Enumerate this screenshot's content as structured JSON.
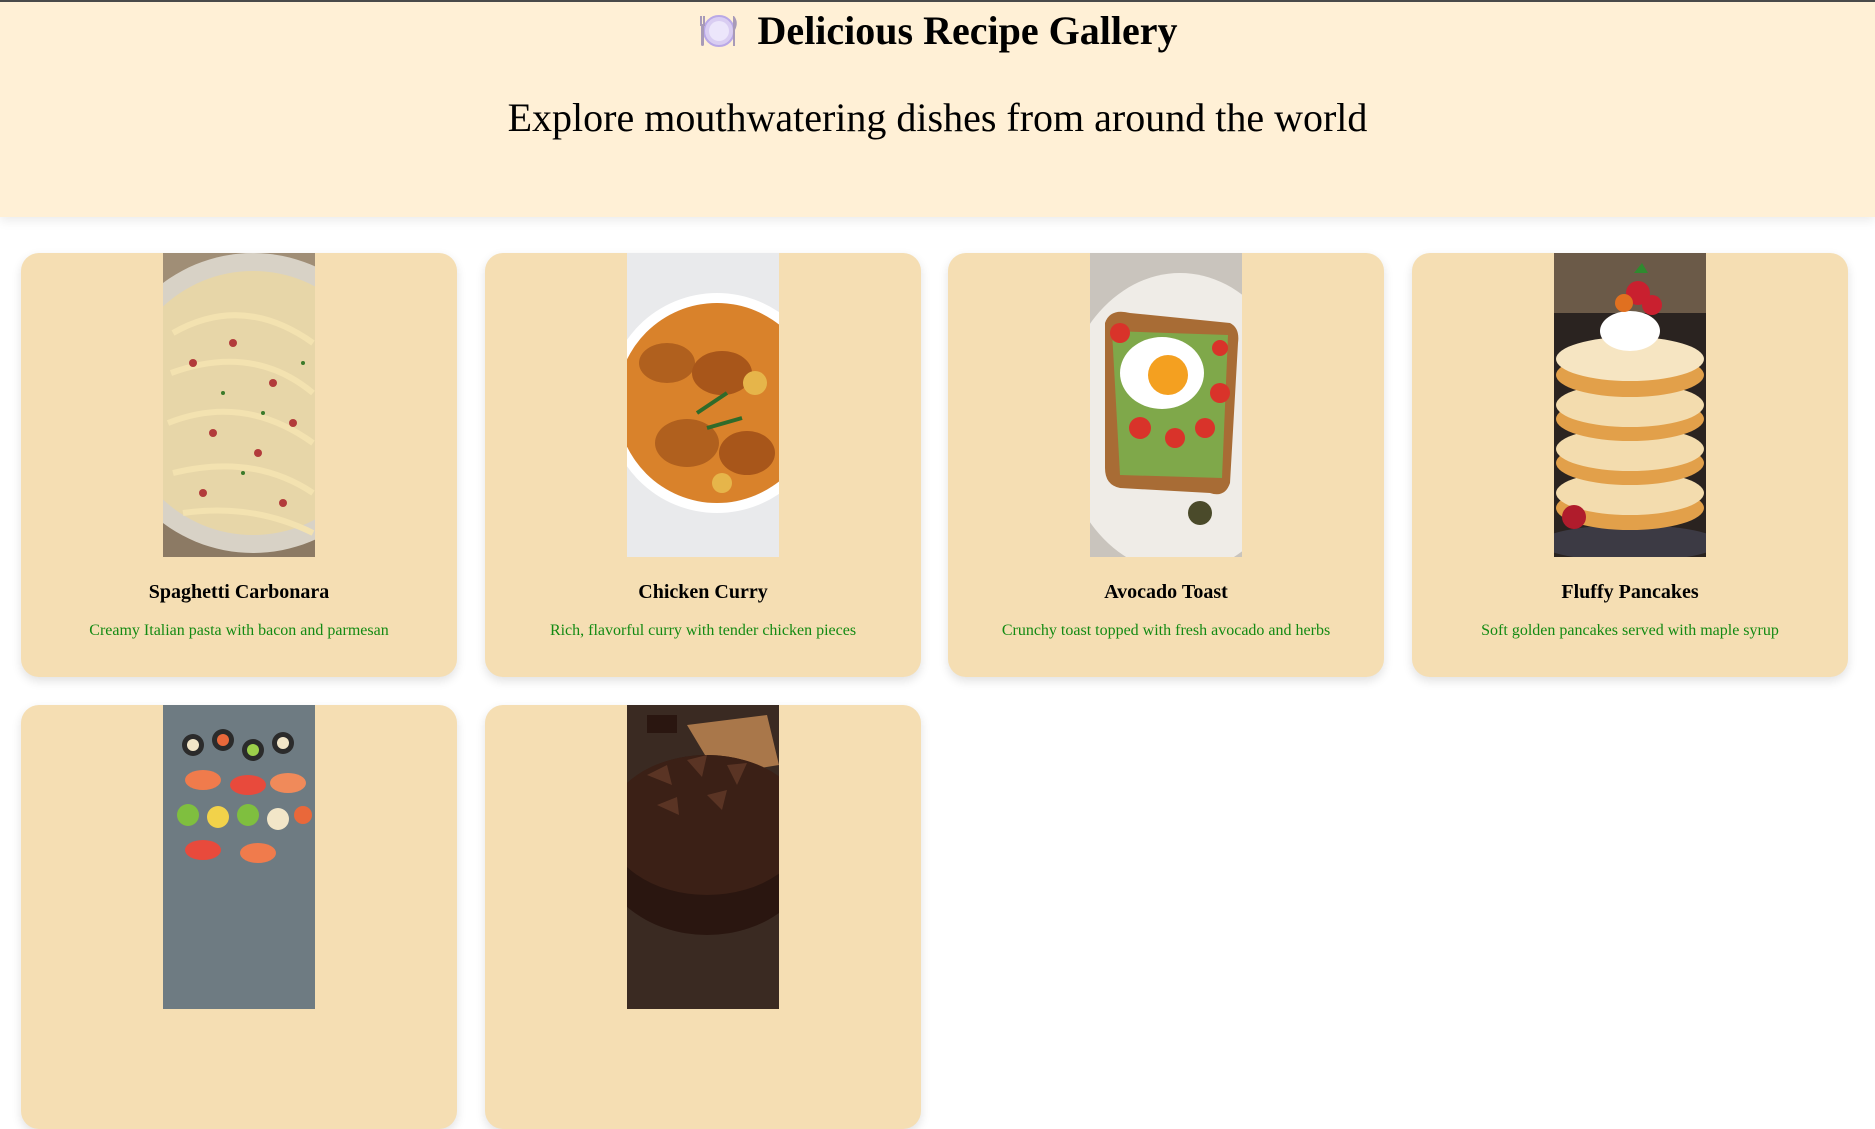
{
  "header": {
    "icon": "plate-with-cutlery-icon",
    "title": "Delicious Recipe Gallery",
    "subtitle": "Explore mouthwatering dishes from around the world"
  },
  "colors": {
    "header_bg": "#fff0d6",
    "card_bg": "#f5deb3",
    "description_text": "#138a13"
  },
  "recipes": [
    {
      "name": "Spaghetti Carbonara",
      "description": "Creamy Italian pasta with bacon and parmesan",
      "image": "spaghetti-carbonara-photo"
    },
    {
      "name": "Chicken Curry",
      "description": "Rich, flavorful curry with tender chicken pieces",
      "image": "chicken-curry-photo"
    },
    {
      "name": "Avocado Toast",
      "description": "Crunchy toast topped with fresh avocado and herbs",
      "image": "avocado-toast-photo"
    },
    {
      "name": "Fluffy Pancakes",
      "description": "Soft golden pancakes served with maple syrup",
      "image": "fluffy-pancakes-photo"
    },
    {
      "name": "",
      "description": "",
      "image": "sushi-platter-photo"
    },
    {
      "name": "",
      "description": "",
      "image": "chocolate-cake-photo"
    }
  ]
}
